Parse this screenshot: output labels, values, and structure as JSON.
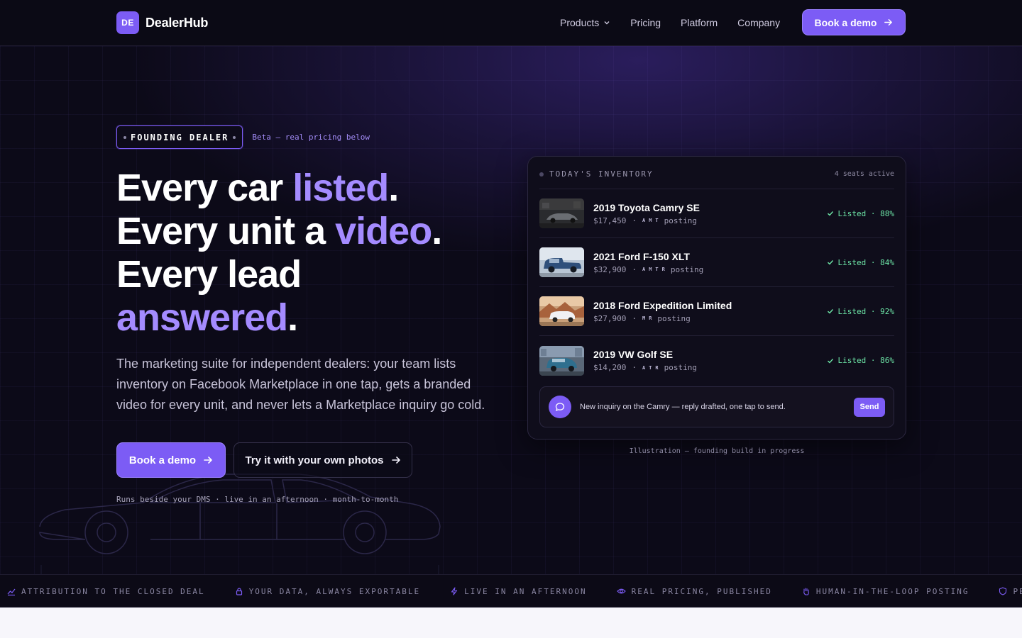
{
  "nav": {
    "brand_mark": "DE",
    "brand_name": "DealerHub",
    "links": [
      "Products",
      "Pricing",
      "Platform",
      "Company"
    ],
    "cta": "Book a demo"
  },
  "hero": {
    "badge": "FOUNDING DEALER",
    "badge_note": "Beta — real pricing below",
    "line1_plain": "Every car ",
    "line1_accent": "listed",
    "line2_plain": "Every unit a ",
    "line2_accent": "video",
    "line3_plain": "Every lead",
    "line4_accent": "answered",
    "period": ".",
    "lede": "The marketing suite for independent dealers: your team lists inventory on Facebook Marketplace in one tap, gets a branded video for every unit, and never lets a Marketplace inquiry go cold.",
    "primary_cta": "Book a demo",
    "secondary_cta": "Try it with your own photos",
    "fine_print": "Runs beside your DMS · live in an afternoon · month-to-month"
  },
  "inventory": {
    "title": "TODAY'S INVENTORY",
    "seats": "4 seats active",
    "items": [
      {
        "name": "2019 Toyota Camry SE",
        "price": "$17,450",
        "sep": "·",
        "chips": [
          "A",
          "M",
          "T"
        ],
        "state": "posting",
        "status": "Listed · 88%"
      },
      {
        "name": "2021 Ford F-150 XLT",
        "price": "$32,900",
        "sep": "·",
        "chips": [
          "A",
          "M",
          "T",
          "R"
        ],
        "state": "posting",
        "status": "Listed · 84%"
      },
      {
        "name": "2018 Ford Expedition Limited",
        "price": "$27,900",
        "sep": "·",
        "chips": [
          "M",
          "R"
        ],
        "state": "posting",
        "status": "Listed · 92%"
      },
      {
        "name": "2019 VW Golf SE",
        "price": "$14,200",
        "sep": "·",
        "chips": [
          "A",
          "T",
          "R"
        ],
        "state": "posting",
        "status": "Listed · 86%"
      }
    ],
    "inquiry": "New inquiry on the Camry — reply drafted, one tap to send.",
    "send": "Send",
    "caption": "Illustration — founding build in progress"
  },
  "ticker": [
    {
      "icon": "chart-icon",
      "label": "ATTRIBUTION TO THE CLOSED DEAL"
    },
    {
      "icon": "lock-icon",
      "label": "YOUR DATA, ALWAYS EXPORTABLE"
    },
    {
      "icon": "bolt-icon",
      "label": "LIVE IN AN AFTERNOON"
    },
    {
      "icon": "eye-icon",
      "label": "REAL PRICING, PUBLISHED"
    },
    {
      "icon": "hand-icon",
      "label": "HUMAN-IN-THE-LOOP POSTING"
    },
    {
      "icon": "shield-icon",
      "label": "PER-SEAT"
    }
  ],
  "colors": {
    "accent": "#7c5cf5",
    "accent_light": "#a48bff",
    "success": "#6ee7a8",
    "background": "#0c0a18"
  }
}
